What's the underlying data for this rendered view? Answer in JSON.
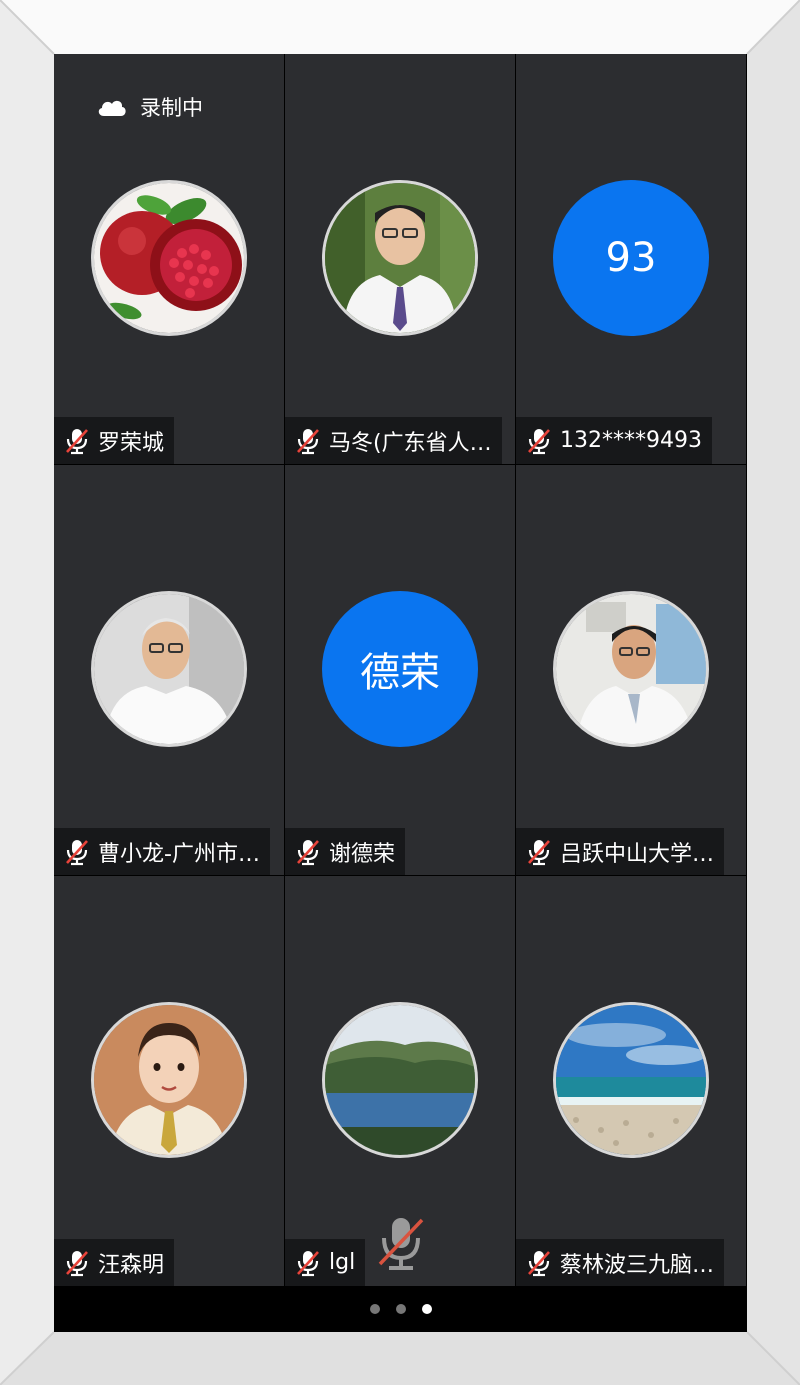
{
  "recording": {
    "label": "录制中",
    "icon": "cloud-icon"
  },
  "participants": [
    {
      "name": "罗荣城",
      "avatar": "pomegranate-photo"
    },
    {
      "name": "马冬(广东省人…",
      "avatar": "doctor-photo"
    },
    {
      "name": "132****9493",
      "avatar_text": "93",
      "avatar_color": "#0a75f0"
    },
    {
      "name": "曹小龙-广州市…",
      "avatar": "man-photo"
    },
    {
      "name": "谢德荣",
      "avatar_text": "德荣",
      "avatar_color": "#0a75f0"
    },
    {
      "name": "吕跃中山大学…",
      "avatar": "doctor-office-photo"
    },
    {
      "name": "汪森明",
      "avatar": "cartoon-man-illustration"
    },
    {
      "name": "lgl",
      "avatar": "mountain-lake-photo"
    },
    {
      "name": "蔡林波三九脑…",
      "avatar": "beach-photo"
    }
  ],
  "pagination": {
    "total": 3,
    "active": 3
  },
  "colors": {
    "tile_bg": "#2c2d30",
    "avatar_blue": "#0a75f0",
    "muted_red": "#e8433a"
  }
}
